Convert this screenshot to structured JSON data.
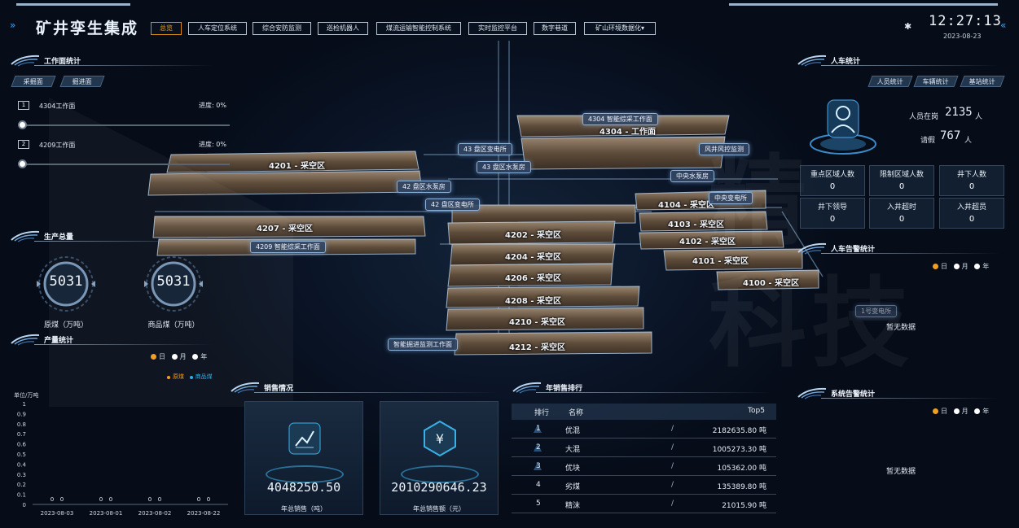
{
  "header": {
    "title": "矿井孪生集成",
    "nav": [
      "总览",
      "人车定位系统",
      "综合安防监测",
      "巡检机器人",
      "煤流运输智能控制系统",
      "实时监控平台",
      "数字巷道",
      "矿山环境数据化▾"
    ],
    "time": "12:27:13",
    "date": "2023-08-23"
  },
  "workface": {
    "title": "工作面统计",
    "tabs": [
      "采掘面",
      "掘进面"
    ],
    "items": [
      {
        "idx": "1",
        "name": "4304工作面",
        "progress_label": "进度: 0%",
        "progress": 0
      },
      {
        "idx": "2",
        "name": "4209工作面",
        "progress_label": "进度: 0%",
        "progress": 0
      }
    ]
  },
  "production": {
    "title": "生产总量",
    "gauges": [
      {
        "value": "5031",
        "label": "原煤（万吨）"
      },
      {
        "value": "5031",
        "label": "商品煤（万吨）"
      }
    ]
  },
  "output": {
    "title": "产量统计",
    "periods": [
      "日",
      "月",
      "年"
    ],
    "selected_period": "日",
    "legend": [
      "原煤",
      "商品煤"
    ],
    "unit": "单位/万吨"
  },
  "chart_data": {
    "type": "bar",
    "categories": [
      "2023-08-03",
      "2023-08-01",
      "2023-08-02",
      "2023-08-22"
    ],
    "series": [
      {
        "name": "原煤",
        "values": [
          0,
          0,
          0,
          0
        ]
      },
      {
        "name": "商品煤",
        "values": [
          0,
          0,
          0,
          0
        ]
      }
    ],
    "ylabel": "单位/万吨",
    "yticks": [
      "1",
      "0.9",
      "0.8",
      "0.7",
      "0.6",
      "0.5",
      "0.4",
      "0.3",
      "0.2",
      "0.1",
      "0"
    ],
    "ylim": [
      0,
      1
    ],
    "colors": [
      "#f0a020",
      "#2ab0e8"
    ]
  },
  "sales": {
    "title": "销售情况",
    "cards": [
      {
        "icon": "line-chart-icon",
        "value": "4048250.50",
        "label": "年总销售（吨）"
      },
      {
        "icon": "yen-icon",
        "value": "2010290646.23",
        "label": "年总销售额（元）"
      }
    ]
  },
  "ranking": {
    "title": "年销售排行",
    "headers": [
      "排行",
      "名称",
      "Top5"
    ],
    "rows": [
      {
        "rank": "1",
        "name": "优混",
        "sep": "/",
        "value": "2182635.80 吨"
      },
      {
        "rank": "2",
        "name": "大混",
        "sep": "/",
        "value": "1005273.30 吨"
      },
      {
        "rank": "3",
        "name": "优块",
        "sep": "/",
        "value": "105362.00 吨"
      },
      {
        "rank": "4",
        "name": "劣煤",
        "sep": "/",
        "value": "135389.80 吨"
      },
      {
        "rank": "5",
        "name": "精沫",
        "sep": "/",
        "value": "21015.90 吨"
      }
    ]
  },
  "people": {
    "title": "人车统计",
    "tabs": [
      "人员统计",
      "车辆统计",
      "基站统计"
    ],
    "onduty_label": "人员在岗",
    "onduty_value": "2135",
    "onduty_unit": "人",
    "leave_label": "请假",
    "leave_value": "767",
    "leave_unit": "人",
    "cells": [
      {
        "k": "重点区域人数",
        "v": "0"
      },
      {
        "k": "限制区域人数",
        "v": "0"
      },
      {
        "k": "井下人数",
        "v": "0"
      },
      {
        "k": "井下领导",
        "v": "0"
      },
      {
        "k": "入井超时",
        "v": "0"
      },
      {
        "k": "入井超员",
        "v": "0"
      }
    ]
  },
  "people_alarm": {
    "title": "人车告警统计",
    "periods": [
      "日",
      "月",
      "年"
    ],
    "selected_period": "日",
    "empty": "暂无数据",
    "faded_tag": "1号变电所"
  },
  "system_alarm": {
    "title": "系统告警统计",
    "periods": [
      "日",
      "月",
      "年"
    ],
    "selected_period": "日",
    "empty": "暂无数据"
  },
  "map": {
    "zones": [
      "4201 - 采空区",
      "4207 - 采空区",
      "4304 - 工作面",
      "4202 - 采空区",
      "4204 - 采空区",
      "4206 - 采空区",
      "4208 - 采空区",
      "4210 - 采空区",
      "4212 - 采空区",
      "4104 - 采空区",
      "4103 - 采空区",
      "4102 - 采空区",
      "4101 - 采空区",
      "4100 - 采空区"
    ],
    "tags": [
      "4304 智能综采工作面",
      "43 盘区变电所",
      "43 盘区水泵房",
      "风井风控监测",
      "中央水泵房",
      "中央变电所",
      "42 盘区水泵房",
      "42 盘区变电所",
      "4209 智能综采工作面",
      "智能掘进监测工作面"
    ]
  },
  "watermark": [
    "精",
    "科技"
  ]
}
